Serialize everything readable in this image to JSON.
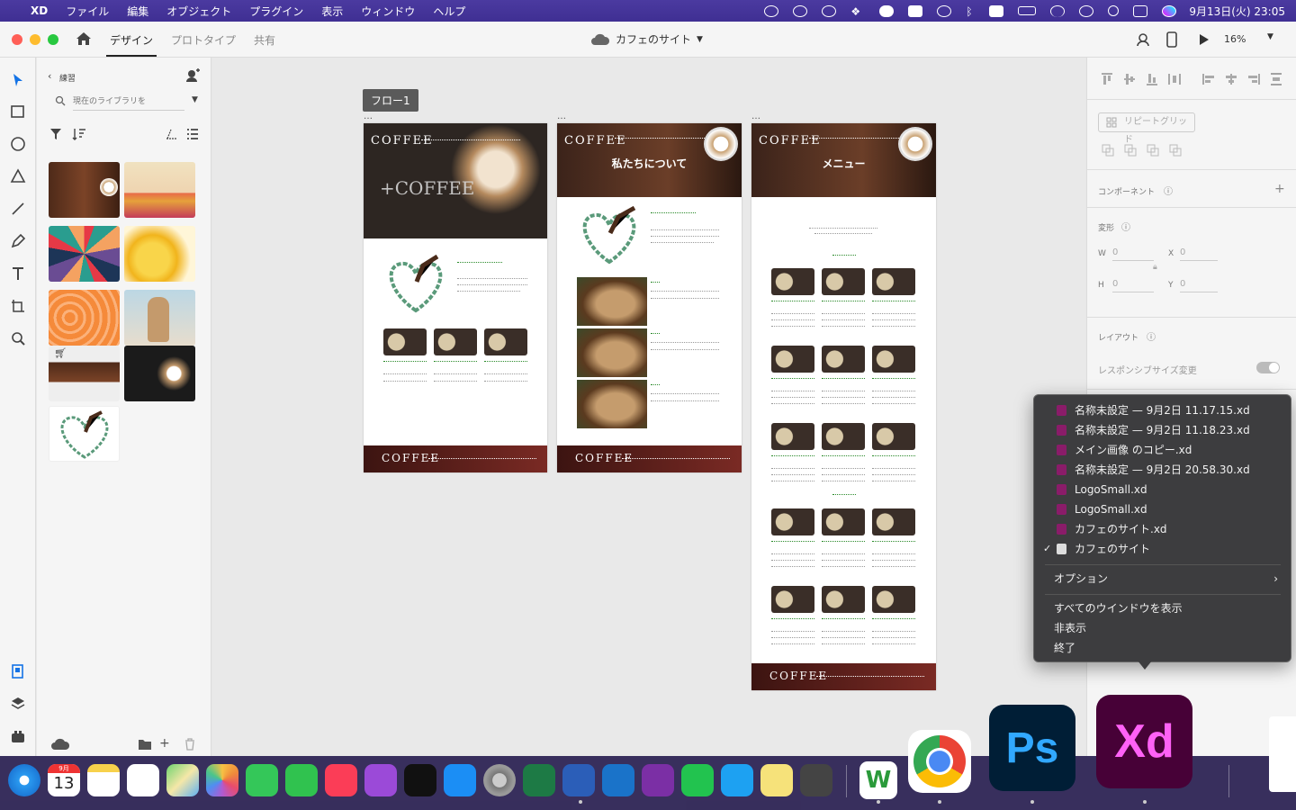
{
  "menubar": {
    "app": "XD",
    "items": [
      "ファイル",
      "編集",
      "オブジェクト",
      "プラグイン",
      "表示",
      "ウィンドウ",
      "ヘルプ"
    ],
    "clock": "9月13日(火) 23:05"
  },
  "titlebar": {
    "tabs": [
      "デザイン",
      "プロトタイプ",
      "共有"
    ],
    "active_tab": "デザイン",
    "document_title": "カフェのサイト",
    "zoom": "16%"
  },
  "library": {
    "back_label": "練習",
    "search_placeholder": "現在のライブラリを"
  },
  "canvas": {
    "flow_label": "フロー1",
    "artboards": [
      {
        "hero_logo": "COFFEE",
        "hero_title": "",
        "footer_logo": "COFFEE"
      },
      {
        "hero_logo": "COFFEE",
        "hero_title": "私たちについて",
        "footer_logo": "COFFEE"
      },
      {
        "hero_logo": "COFFEE",
        "hero_title": "メニュー",
        "footer_logo": "COFFEE"
      }
    ]
  },
  "properties": {
    "repeat_grid": "リピートグリッド",
    "component": "コンポーネント",
    "transform": "変形",
    "w_label": "W",
    "w_value": "0",
    "x_label": "X",
    "x_value": "0",
    "h_label": "H",
    "h_value": "0",
    "y_label": "Y",
    "y_value": "0",
    "layout": "レイアウト",
    "responsive": "レスポンシブサイズ変更"
  },
  "dock_menu": {
    "files": [
      "名称未設定 — 9月2日 11.17.15.xd",
      "名称未設定 — 9月2日 11.18.23.xd",
      "メイン画像 のコピー.xd",
      "名称未設定 — 9月2日 20.58.30.xd",
      "LogoSmall.xd",
      "LogoSmall.xd",
      "カフェのサイト.xd"
    ],
    "current_window": "カフェのサイト",
    "options": "オプション",
    "show_all": "すべてのウインドウを表示",
    "hide": "非表示",
    "quit": "終了"
  },
  "dock": {
    "calendar_month": "9月",
    "calendar_day": "13",
    "ps_label": "Ps",
    "xd_label": "Xd",
    "word_label": "W"
  },
  "colors": {
    "accent_purple": "#470137",
    "xd_pink": "#ff61f6",
    "ps_blue": "#31a8ff",
    "menubar": "#4b3aa0"
  }
}
